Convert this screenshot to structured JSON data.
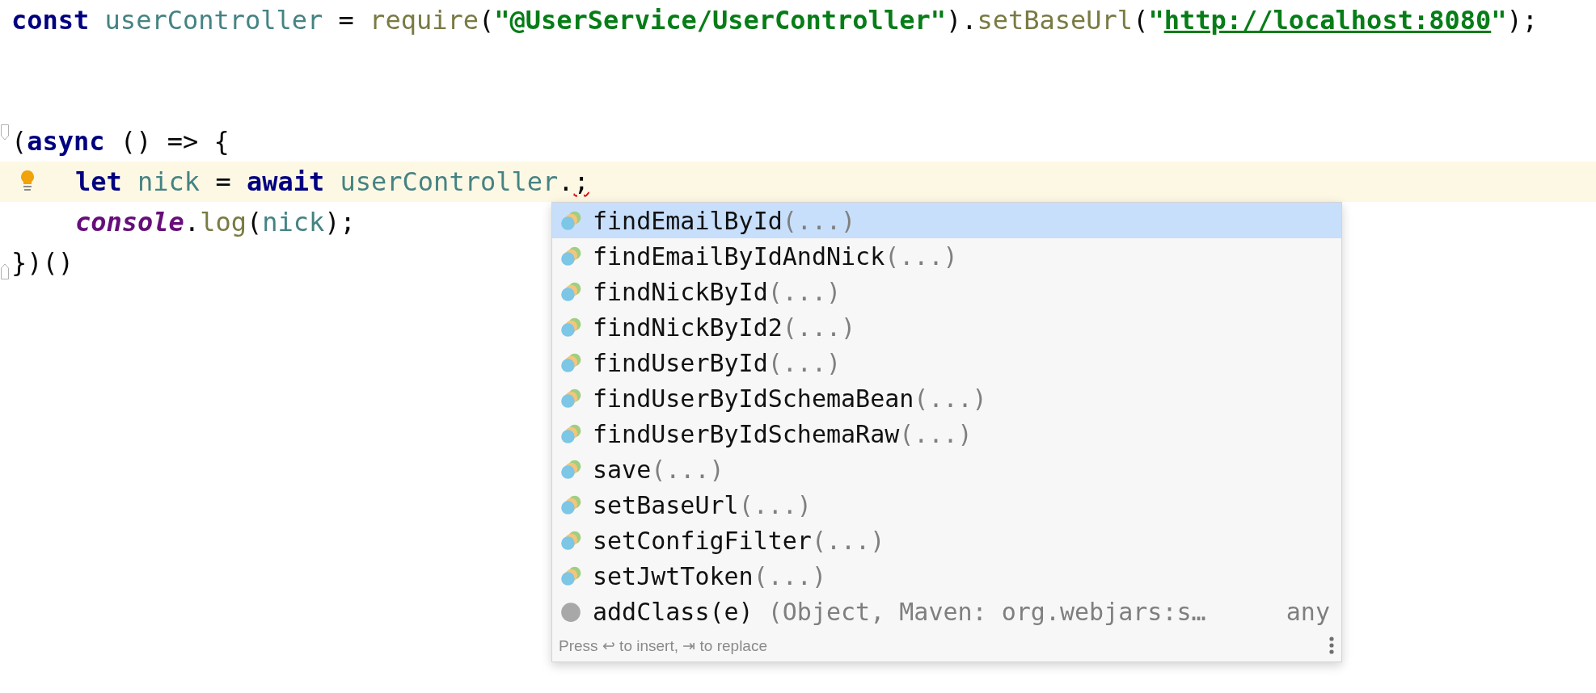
{
  "editor": {
    "lines": [
      {
        "kind": "code",
        "current": false,
        "indented": false,
        "fold_start": false,
        "fold_end": false,
        "tokens": [
          {
            "text": "const",
            "kind": "keyword"
          },
          {
            "text": " userController",
            "kind": "identifier"
          },
          {
            "text": " = ",
            "kind": "plain"
          },
          {
            "text": "require",
            "kind": "function"
          },
          {
            "text": "(",
            "kind": "plain"
          },
          {
            "text": "\"@UserService/UserController\"",
            "kind": "string"
          },
          {
            "text": ").",
            "kind": "plain"
          },
          {
            "text": "setBaseUrl",
            "kind": "function"
          },
          {
            "text": "(",
            "kind": "plain"
          },
          {
            "text": "\"",
            "kind": "string"
          },
          {
            "text": "http://localhost:8080",
            "kind": "url"
          },
          {
            "text": "\"",
            "kind": "string"
          },
          {
            "text": ");",
            "kind": "plain"
          }
        ]
      },
      {
        "kind": "blank"
      },
      {
        "kind": "blank"
      },
      {
        "kind": "code",
        "current": false,
        "indented": false,
        "fold_start": true,
        "fold_end": false,
        "tokens": [
          {
            "text": "(",
            "kind": "plain"
          },
          {
            "text": "async",
            "kind": "keyword"
          },
          {
            "text": " () => {",
            "kind": "plain"
          }
        ]
      },
      {
        "kind": "code",
        "current": true,
        "indented": true,
        "fold_start": false,
        "fold_end": false,
        "tokens": [
          {
            "text": "let",
            "kind": "keyword"
          },
          {
            "text": " nick",
            "kind": "identifier"
          },
          {
            "text": " = ",
            "kind": "plain"
          },
          {
            "text": "await",
            "kind": "keyword"
          },
          {
            "text": " userController",
            "kind": "identifier"
          },
          {
            "text": ".",
            "kind": "plain"
          },
          {
            "text": ";",
            "kind": "error"
          }
        ]
      },
      {
        "kind": "code",
        "current": false,
        "indented": true,
        "fold_start": false,
        "fold_end": false,
        "tokens": [
          {
            "text": "console",
            "kind": "global"
          },
          {
            "text": ".",
            "kind": "plain"
          },
          {
            "text": "log",
            "kind": "function"
          },
          {
            "text": "(",
            "kind": "plain"
          },
          {
            "text": "nick",
            "kind": "identifier"
          },
          {
            "text": ");",
            "kind": "plain"
          }
        ]
      },
      {
        "kind": "code",
        "current": false,
        "indented": false,
        "fold_start": false,
        "fold_end": true,
        "tokens": [
          {
            "text": "})()",
            "kind": "plain"
          }
        ]
      }
    ]
  },
  "completion": {
    "items": [
      {
        "kind": "method",
        "name": "findEmailById",
        "params": "(...)",
        "selected": true
      },
      {
        "kind": "method",
        "name": "findEmailByIdAndNick",
        "params": "(...)",
        "selected": false
      },
      {
        "kind": "method",
        "name": "findNickById",
        "params": "(...)",
        "selected": false
      },
      {
        "kind": "method",
        "name": "findNickById2",
        "params": "(...)",
        "selected": false
      },
      {
        "kind": "method",
        "name": "findUserById",
        "params": "(...)",
        "selected": false
      },
      {
        "kind": "method",
        "name": "findUserByIdSchemaBean",
        "params": "(...)",
        "selected": false
      },
      {
        "kind": "method",
        "name": "findUserByIdSchemaRaw",
        "params": "(...)",
        "selected": false
      },
      {
        "kind": "method",
        "name": "save",
        "params": "(...)",
        "selected": false
      },
      {
        "kind": "method",
        "name": "setBaseUrl",
        "params": "(...)",
        "selected": false
      },
      {
        "kind": "method",
        "name": "setConfigFilter",
        "params": "(...)",
        "selected": false
      },
      {
        "kind": "method",
        "name": "setJwtToken",
        "params": "(...)",
        "selected": false
      },
      {
        "kind": "library",
        "name": "addClass(e)",
        "params": "(Object, Maven: org.webjars:s…",
        "type": "any",
        "selected": false
      }
    ],
    "hint": "Press ↩ to insert, ⇥ to replace"
  }
}
